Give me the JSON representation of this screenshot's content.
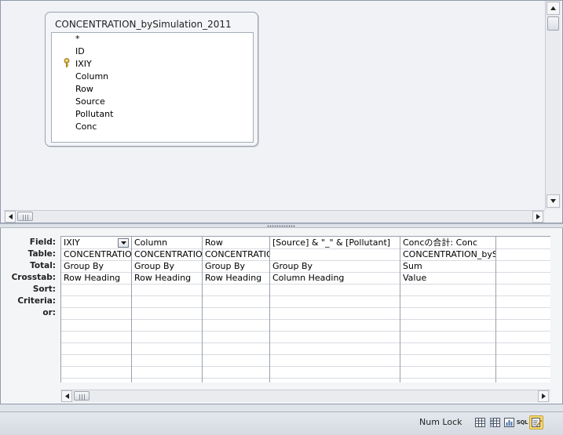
{
  "design_table": {
    "title": "CONCENTRATION_bySimulation_2011",
    "fields": [
      "*",
      "ID",
      "IXIY",
      "Column",
      "Row",
      "Source",
      "Pollutant",
      "Conc"
    ]
  },
  "grid": {
    "row_labels": [
      "Field:",
      "Table:",
      "Total:",
      "Crosstab:",
      "Sort:",
      "Criteria:",
      "or:"
    ],
    "columns": [
      {
        "field": "IXIY",
        "table": "CONCENTRATION",
        "total": "Group By",
        "crosstab": "Row Heading",
        "sort": "",
        "criteria": "",
        "or": ""
      },
      {
        "field": "Column",
        "table": "CONCENTRATION",
        "total": "Group By",
        "crosstab": "Row Heading",
        "sort": "",
        "criteria": "",
        "or": ""
      },
      {
        "field": "Row",
        "table": "CONCENTRATIO",
        "total": "Group By",
        "crosstab": "Row Heading",
        "sort": "",
        "criteria": "",
        "or": ""
      },
      {
        "field": "[Source] & \"_\" & [Pollutant]",
        "table": "",
        "total": "Group By",
        "crosstab": "Column Heading",
        "sort": "",
        "criteria": "",
        "or": ""
      },
      {
        "field": "Concの合計: Conc",
        "table": "CONCENTRATION_bySi",
        "total": "Sum",
        "crosstab": "Value",
        "sort": "",
        "criteria": "",
        "or": ""
      },
      {
        "field": "",
        "table": "",
        "total": "",
        "crosstab": "",
        "sort": "",
        "criteria": "",
        "or": ""
      }
    ]
  },
  "statusbar": {
    "num_lock": "Num Lock",
    "views": [
      "datasheet-view-icon",
      "pivot-table-view-icon",
      "pivot-chart-view-icon",
      "sql-view-icon",
      "design-view-icon"
    ],
    "sql_text": "SQL"
  },
  "colors": {
    "accent": "#f7d96c",
    "pane_bg": "#f1f2f6",
    "border": "#8f9aa8"
  }
}
